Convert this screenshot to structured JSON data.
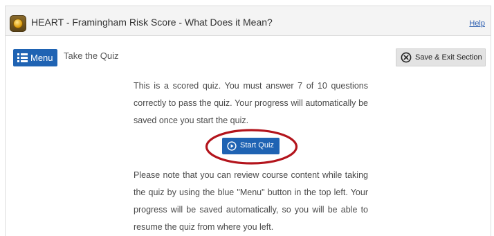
{
  "window": {
    "title": "HEART - Framingham Risk Score - What Does it Mean?",
    "help_label": "Help",
    "app_icon": "coin-icon"
  },
  "toolbar": {
    "menu_label": "Menu",
    "menu_icon": "list-menu-icon",
    "page_heading": "Take the Quiz",
    "save_exit_label": "Save & Exit Section",
    "save_exit_icon": "circle-x-icon"
  },
  "quiz": {
    "intro": "This is a scored quiz. You must answer 7 of 10 questions correctly to pass the quiz. Your progress will automatically be saved once you start the quiz.",
    "start_label": "Start Quiz",
    "start_icon": "play-circle-icon",
    "note": "Please note that you can review course content while taking the quiz by using the blue \"Menu\" button in the top left. Your progress will be saved automatically, so you will be able to resume the quiz from where you left."
  },
  "colors": {
    "accent_blue": "#1f63b3",
    "highlight_red": "#b3141c",
    "titlebar_bg": "#f4f4f4",
    "save_button_bg": "#e3e3e3"
  }
}
